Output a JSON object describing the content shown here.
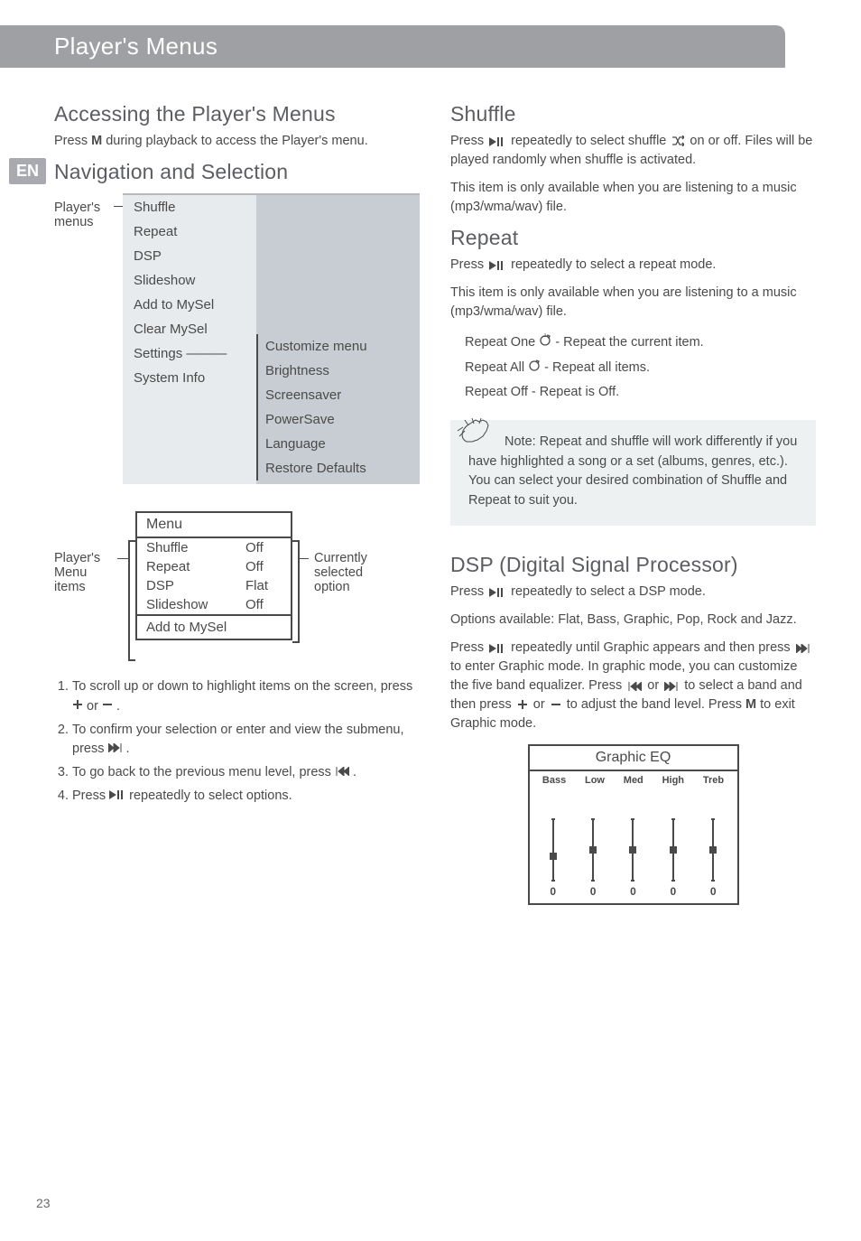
{
  "header": {
    "title": "Player's Menus",
    "lang_tag": "EN"
  },
  "left": {
    "h_accessing": "Accessing the Player's Menus",
    "accessing_body_1": "Press ",
    "accessing_body_bold": "M",
    "accessing_body_2": " during playback to access the Player's menu.",
    "h_navsel": "Navigation and Selection",
    "nav_left_label_1": "Player's",
    "nav_left_label_2": "menus",
    "menu_col1": [
      "Shuffle",
      "Repeat",
      "DSP",
      "Slideshow",
      "Add to MySel",
      "Clear MySel",
      "Settings",
      "System Info"
    ],
    "menu_col2": [
      "Customize menu",
      "Brightness",
      "Screensaver",
      "PowerSave",
      "Language",
      "Restore Defaults"
    ],
    "phone_left_label": "Player's Menu items",
    "phone_right_label": "Currently selected option",
    "phone_title": "Menu",
    "phone_rows": [
      {
        "l": "Shuffle",
        "r": "Off"
      },
      {
        "l": "Repeat",
        "r": "Off"
      },
      {
        "l": "DSP",
        "r": "Flat"
      },
      {
        "l": "Slideshow",
        "r": "Off"
      }
    ],
    "phone_footer": "Add to MySel",
    "steps": {
      "s1a": "To scroll up or down to highlight items on the screen, press ",
      "s1b": " or ",
      "s1c": " .",
      "s2a": "To confirm your selection or enter and view the submenu, press ",
      "s2b": " .",
      "s3a": "To go back to the previous menu level, press ",
      "s3b": " .",
      "s4a": "Press ",
      "s4b": " repeatedly to select options."
    }
  },
  "right": {
    "h_shuffle": "Shuffle",
    "shuffle_body_pre": "Press ",
    "shuffle_body_mid": " repeatedly to select shuffle ",
    "shuffle_body_post": " on or off. Files will be played randomly when shuffle is activated.",
    "shuffle_body_line2": "This item is only available when you are listening to a music (mp3/wma/wav) file.",
    "h_repeat": "Repeat",
    "repeat_body_pre": "Press ",
    "repeat_body_mid": " repeatedly to select a repeat mode.",
    "repeat_body_line2": "This item is only available when you are listening to a music (mp3/wma/wav) file.",
    "repeat_list": {
      "r1a": "Repeat One ",
      "r1b": " - Repeat the current item.",
      "r2a": "Repeat All ",
      "r2b": " - Repeat all items.",
      "r3": "Repeat Off - Repeat is Off."
    },
    "note_bold": "Note:",
    "note_text": " Repeat and shuffle will work differently if you have highlighted a song or a set (albums, genres, etc.). You can select your desired combination of Shuffle and Repeat to suit you.",
    "h_dsp": "DSP (Digital Signal Processor)",
    "dsp_body_pre": "Press ",
    "dsp_body_mid": " repeatedly to select a DSP mode.",
    "dsp_body_line2": "Options available: Flat, Bass, Graphic, Pop, Rock and Jazz.",
    "dsp2_a": "Press ",
    "dsp2_b": " repeatedly until Graphic appears and then press ",
    "dsp2_c": " to enter Graphic mode. In graphic mode, you can customize the five band equalizer. Press ",
    "dsp2_d": " or ",
    "dsp2_e": " to select a band and then press ",
    "dsp2_f": " or ",
    "dsp2_g": " to adjust the band level. Press ",
    "dsp2_g_bold": "M",
    "dsp2_h": " to exit Graphic mode.",
    "eq_title": "Graphic EQ",
    "eq_labels": [
      "Bass",
      "Low",
      "Med",
      "High",
      "Treb"
    ],
    "eq_values": [
      "0",
      "0",
      "0",
      "0",
      "0"
    ]
  },
  "page_number": "23",
  "chart_data": {
    "type": "bar",
    "title": "Graphic EQ",
    "categories": [
      "Bass",
      "Low",
      "Med",
      "High",
      "Treb"
    ],
    "values": [
      0,
      0,
      0,
      0,
      0
    ]
  }
}
